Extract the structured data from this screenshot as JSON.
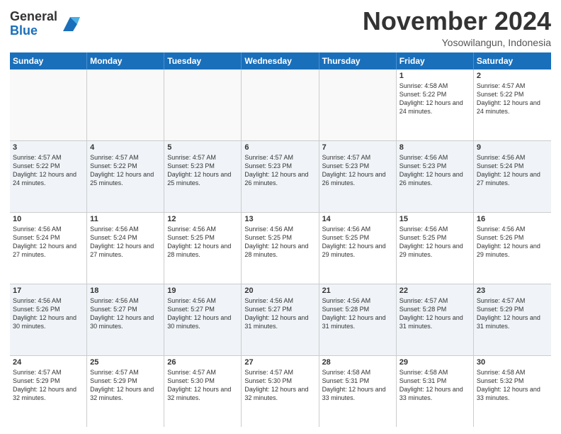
{
  "header": {
    "logo_general": "General",
    "logo_blue": "Blue",
    "month_title": "November 2024",
    "location": "Yosowilangun, Indonesia"
  },
  "days_of_week": [
    "Sunday",
    "Monday",
    "Tuesday",
    "Wednesday",
    "Thursday",
    "Friday",
    "Saturday"
  ],
  "weeks": [
    [
      {
        "day": "",
        "empty": true
      },
      {
        "day": "",
        "empty": true
      },
      {
        "day": "",
        "empty": true
      },
      {
        "day": "",
        "empty": true
      },
      {
        "day": "",
        "empty": true
      },
      {
        "day": "1",
        "sunrise": "Sunrise: 4:58 AM",
        "sunset": "Sunset: 5:22 PM",
        "daylight": "Daylight: 12 hours and 24 minutes."
      },
      {
        "day": "2",
        "sunrise": "Sunrise: 4:57 AM",
        "sunset": "Sunset: 5:22 PM",
        "daylight": "Daylight: 12 hours and 24 minutes."
      }
    ],
    [
      {
        "day": "3",
        "sunrise": "Sunrise: 4:57 AM",
        "sunset": "Sunset: 5:22 PM",
        "daylight": "Daylight: 12 hours and 24 minutes."
      },
      {
        "day": "4",
        "sunrise": "Sunrise: 4:57 AM",
        "sunset": "Sunset: 5:22 PM",
        "daylight": "Daylight: 12 hours and 25 minutes."
      },
      {
        "day": "5",
        "sunrise": "Sunrise: 4:57 AM",
        "sunset": "Sunset: 5:23 PM",
        "daylight": "Daylight: 12 hours and 25 minutes."
      },
      {
        "day": "6",
        "sunrise": "Sunrise: 4:57 AM",
        "sunset": "Sunset: 5:23 PM",
        "daylight": "Daylight: 12 hours and 26 minutes."
      },
      {
        "day": "7",
        "sunrise": "Sunrise: 4:57 AM",
        "sunset": "Sunset: 5:23 PM",
        "daylight": "Daylight: 12 hours and 26 minutes."
      },
      {
        "day": "8",
        "sunrise": "Sunrise: 4:56 AM",
        "sunset": "Sunset: 5:23 PM",
        "daylight": "Daylight: 12 hours and 26 minutes."
      },
      {
        "day": "9",
        "sunrise": "Sunrise: 4:56 AM",
        "sunset": "Sunset: 5:24 PM",
        "daylight": "Daylight: 12 hours and 27 minutes."
      }
    ],
    [
      {
        "day": "10",
        "sunrise": "Sunrise: 4:56 AM",
        "sunset": "Sunset: 5:24 PM",
        "daylight": "Daylight: 12 hours and 27 minutes."
      },
      {
        "day": "11",
        "sunrise": "Sunrise: 4:56 AM",
        "sunset": "Sunset: 5:24 PM",
        "daylight": "Daylight: 12 hours and 27 minutes."
      },
      {
        "day": "12",
        "sunrise": "Sunrise: 4:56 AM",
        "sunset": "Sunset: 5:25 PM",
        "daylight": "Daylight: 12 hours and 28 minutes."
      },
      {
        "day": "13",
        "sunrise": "Sunrise: 4:56 AM",
        "sunset": "Sunset: 5:25 PM",
        "daylight": "Daylight: 12 hours and 28 minutes."
      },
      {
        "day": "14",
        "sunrise": "Sunrise: 4:56 AM",
        "sunset": "Sunset: 5:25 PM",
        "daylight": "Daylight: 12 hours and 29 minutes."
      },
      {
        "day": "15",
        "sunrise": "Sunrise: 4:56 AM",
        "sunset": "Sunset: 5:25 PM",
        "daylight": "Daylight: 12 hours and 29 minutes."
      },
      {
        "day": "16",
        "sunrise": "Sunrise: 4:56 AM",
        "sunset": "Sunset: 5:26 PM",
        "daylight": "Daylight: 12 hours and 29 minutes."
      }
    ],
    [
      {
        "day": "17",
        "sunrise": "Sunrise: 4:56 AM",
        "sunset": "Sunset: 5:26 PM",
        "daylight": "Daylight: 12 hours and 30 minutes."
      },
      {
        "day": "18",
        "sunrise": "Sunrise: 4:56 AM",
        "sunset": "Sunset: 5:27 PM",
        "daylight": "Daylight: 12 hours and 30 minutes."
      },
      {
        "day": "19",
        "sunrise": "Sunrise: 4:56 AM",
        "sunset": "Sunset: 5:27 PM",
        "daylight": "Daylight: 12 hours and 30 minutes."
      },
      {
        "day": "20",
        "sunrise": "Sunrise: 4:56 AM",
        "sunset": "Sunset: 5:27 PM",
        "daylight": "Daylight: 12 hours and 31 minutes."
      },
      {
        "day": "21",
        "sunrise": "Sunrise: 4:56 AM",
        "sunset": "Sunset: 5:28 PM",
        "daylight": "Daylight: 12 hours and 31 minutes."
      },
      {
        "day": "22",
        "sunrise": "Sunrise: 4:57 AM",
        "sunset": "Sunset: 5:28 PM",
        "daylight": "Daylight: 12 hours and 31 minutes."
      },
      {
        "day": "23",
        "sunrise": "Sunrise: 4:57 AM",
        "sunset": "Sunset: 5:29 PM",
        "daylight": "Daylight: 12 hours and 31 minutes."
      }
    ],
    [
      {
        "day": "24",
        "sunrise": "Sunrise: 4:57 AM",
        "sunset": "Sunset: 5:29 PM",
        "daylight": "Daylight: 12 hours and 32 minutes."
      },
      {
        "day": "25",
        "sunrise": "Sunrise: 4:57 AM",
        "sunset": "Sunset: 5:29 PM",
        "daylight": "Daylight: 12 hours and 32 minutes."
      },
      {
        "day": "26",
        "sunrise": "Sunrise: 4:57 AM",
        "sunset": "Sunset: 5:30 PM",
        "daylight": "Daylight: 12 hours and 32 minutes."
      },
      {
        "day": "27",
        "sunrise": "Sunrise: 4:57 AM",
        "sunset": "Sunset: 5:30 PM",
        "daylight": "Daylight: 12 hours and 32 minutes."
      },
      {
        "day": "28",
        "sunrise": "Sunrise: 4:58 AM",
        "sunset": "Sunset: 5:31 PM",
        "daylight": "Daylight: 12 hours and 33 minutes."
      },
      {
        "day": "29",
        "sunrise": "Sunrise: 4:58 AM",
        "sunset": "Sunset: 5:31 PM",
        "daylight": "Daylight: 12 hours and 33 minutes."
      },
      {
        "day": "30",
        "sunrise": "Sunrise: 4:58 AM",
        "sunset": "Sunset: 5:32 PM",
        "daylight": "Daylight: 12 hours and 33 minutes."
      }
    ]
  ]
}
